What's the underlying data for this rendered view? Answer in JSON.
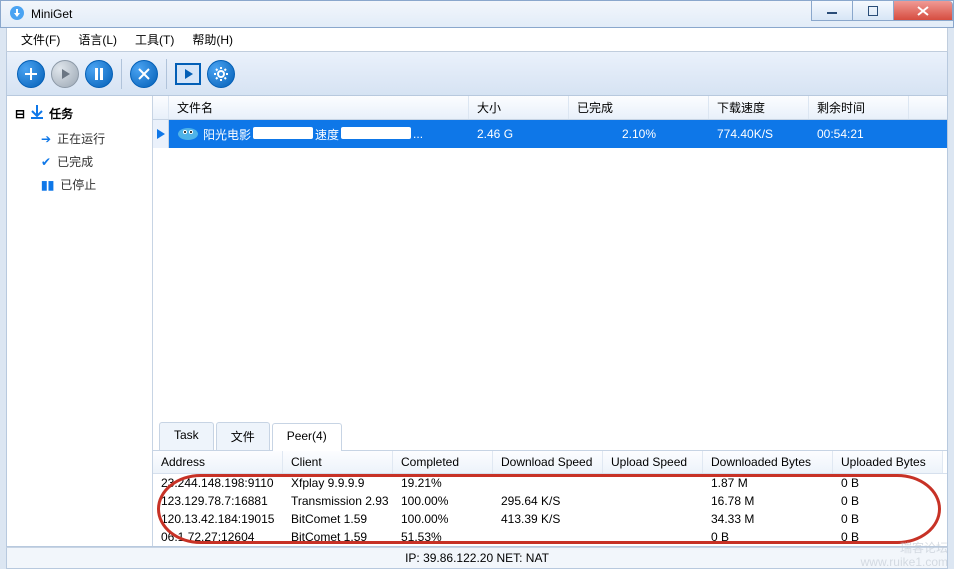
{
  "title": "MiniGet",
  "menu": {
    "file": "文件(F)",
    "lang": "语言(L)",
    "tools": "工具(T)",
    "help": "帮助(H)"
  },
  "sidebar": {
    "header": "任务",
    "items": [
      "正在运行",
      "已完成",
      "已停止"
    ]
  },
  "gridHeaders": {
    "filename": "文件名",
    "size": "大小",
    "done": "已完成",
    "speed": "下载速度",
    "remain": "剩余时间"
  },
  "download": {
    "name_prefix": "阳光电影",
    "name_mid": "速度",
    "suffix": "...",
    "size": "2.46 G",
    "completed": "2.10%",
    "speed": "774.40K/S",
    "remain": "00:54:21"
  },
  "tabs": {
    "task": "Task",
    "file": "文件",
    "peer": "Peer(4)"
  },
  "peerHeaders": {
    "addr": "Address",
    "client": "Client",
    "completed": "Completed",
    "dspeed": "Download Speed",
    "uspeed": "Upload Speed",
    "dbytes": "Downloaded Bytes",
    "ubytes": "Uploaded Bytes"
  },
  "peers": [
    {
      "addr": "23.244.148.198:9110",
      "client": "Xfplay 9.9.9.9",
      "completed": "19.21%",
      "dspeed": "",
      "uspeed": "",
      "dbytes": "1.87 M",
      "ubytes": "0 B"
    },
    {
      "addr": "123.129.78.7:16881",
      "client": "Transmission 2.93",
      "completed": "100.00%",
      "dspeed": "295.64 K/S",
      "uspeed": "",
      "dbytes": "16.78 M",
      "ubytes": "0 B"
    },
    {
      "addr": "120.13.42.184:19015",
      "client": "BitComet 1.59",
      "completed": "100.00%",
      "dspeed": "413.39 K/S",
      "uspeed": "",
      "dbytes": "34.33 M",
      "ubytes": "0 B"
    },
    {
      "addr": "06.1.72.27:12604",
      "client": "BitComet 1.59",
      "completed": "51.53%",
      "dspeed": "",
      "uspeed": "",
      "dbytes": "0 B",
      "ubytes": "0 B"
    }
  ],
  "status": "IP: 39.86.122.20 NET: NAT",
  "watermark": {
    "line1": "瑞客论坛",
    "line2": "www.ruike1.com"
  }
}
